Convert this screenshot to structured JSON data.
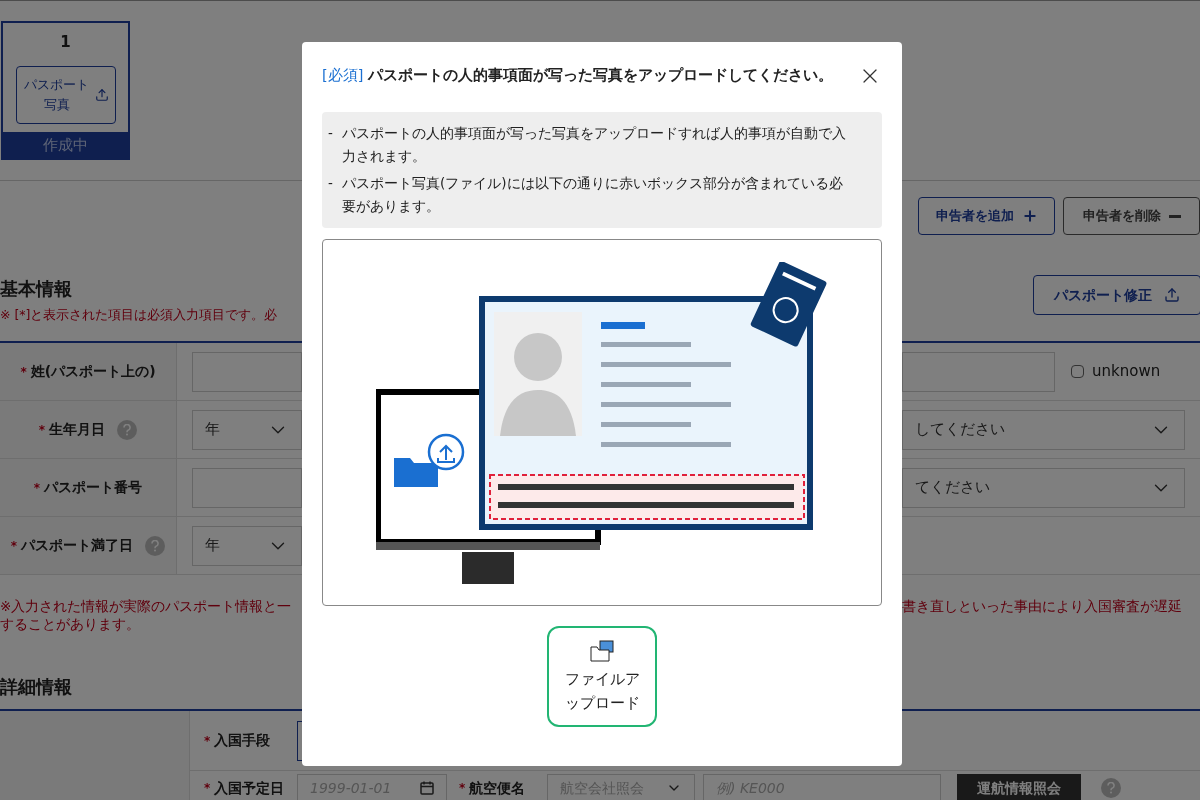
{
  "required_mark": "*",
  "applicant_tabs": [
    {
      "number": "1",
      "button": "パスポート写真",
      "status": "作成中",
      "selected": true
    }
  ],
  "applicant_actions": [
    {
      "label": "申告者を追加",
      "kind": "add"
    },
    {
      "label": "申告者を削除",
      "kind": "remove"
    }
  ],
  "basic_info": {
    "title": "基本情報",
    "note": "※ [*]と表示された項目は必須入力項目です。必",
    "edit_button": "パスポート修正",
    "rows": [
      {
        "label": "姓(パスポート上の)",
        "required": true,
        "help": false,
        "left": {
          "kind": "text"
        },
        "right": {
          "kind": "text"
        },
        "unknown": {
          "label": "unknown",
          "checked": false
        }
      },
      {
        "label": "生年月日",
        "required": true,
        "help": true,
        "left": {
          "kind": "select",
          "value": "年"
        },
        "right": {
          "kind": "select",
          "value": "してください"
        }
      },
      {
        "label": "パスポート番号",
        "required": true,
        "help": false,
        "left": {
          "kind": "text"
        },
        "right": {
          "kind": "select",
          "value": "てください"
        }
      },
      {
        "label": "パスポート満了日",
        "required": true,
        "help": true,
        "left": {
          "kind": "select",
          "value": "年"
        }
      }
    ],
    "warning_left": [
      "※入力された情報が実際のパスポート情報と一",
      "することがあります。"
    ],
    "warning_right": "書き直しといった事由により入国審査が遅延"
  },
  "detail_info": {
    "title": "詳細情報",
    "entry_method": {
      "label": "入国手段",
      "required": true
    },
    "arrival": {
      "label": "入国予定日",
      "required": true,
      "date_placeholder": "1999-01-01",
      "flight_label": "航空便名",
      "flight_required": true,
      "airline_placeholder": "航空会社照会",
      "flight_placeholder": "例) KE000",
      "lookup_button": "運航情報照会"
    }
  },
  "modal": {
    "tag": "[必須]",
    "title": "パスポートの人的事項面が写った写真をアップロードしてください。",
    "notes": [
      "パスポートの人的事項面が写った写真をアップロードすれば人的事項が自動で入力されます。",
      "パスポート写真(ファイル)には以下の通りに赤いボックス部分が含まれている必要があります。"
    ],
    "note_marker": "-",
    "upload_button": "ファイルアップロード"
  }
}
